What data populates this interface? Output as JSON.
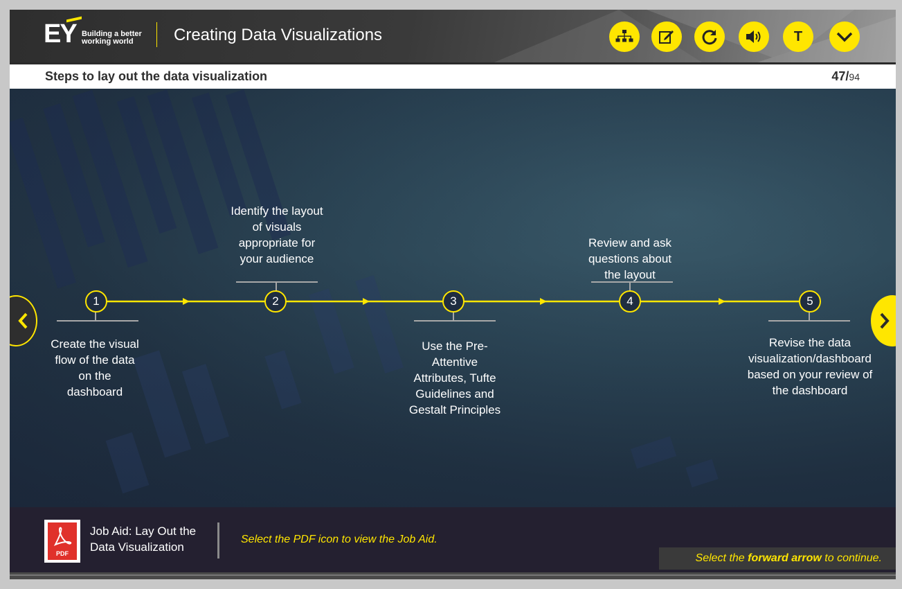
{
  "header": {
    "logo_text": "EY",
    "logo_tagline_1": "Building a better",
    "logo_tagline_2": "working world",
    "course_title": "Creating Data Visualizations",
    "buttons": [
      {
        "icon": "sitemap-icon"
      },
      {
        "icon": "notes-icon"
      },
      {
        "icon": "replay-icon"
      },
      {
        "icon": "audio-icon"
      },
      {
        "label": "T",
        "icon": "transcript-icon"
      },
      {
        "icon": "chevron-down-icon"
      }
    ],
    "accent_color": "#ffe600"
  },
  "subheader": {
    "slide_title": "Steps to lay out the data visualization",
    "page_current": "47/",
    "page_total": "94"
  },
  "steps": [
    {
      "number": "1",
      "text": "Create the visual flow of the data on the dashboard"
    },
    {
      "number": "2",
      "text": "Identify the layout of visuals appropriate for your audience"
    },
    {
      "number": "3",
      "text": "Use the Pre-Attentive Attributes, Tufte Guidelines and Gestalt Principles"
    },
    {
      "number": "4",
      "text": "Review and ask questions about the layout"
    },
    {
      "number": "5",
      "text": "Revise the data visualization/dashboard based on your review of the dashboard"
    }
  ],
  "footer": {
    "pdf_label": "PDF",
    "job_aid_title": "Job Aid: Lay Out the Data Visualization",
    "instruction": "Select the PDF icon to view the Job Aid.",
    "continue_prefix": "Select the ",
    "continue_bold": "forward arrow",
    "continue_suffix": " to continue."
  }
}
